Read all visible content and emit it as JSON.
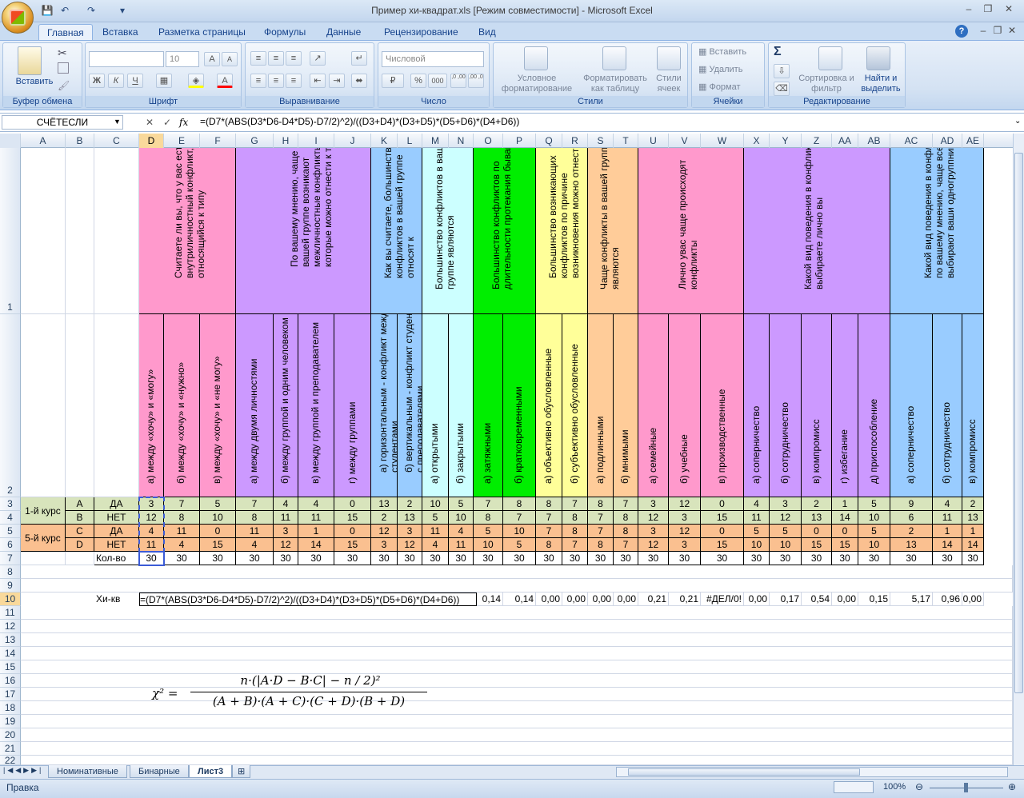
{
  "window": {
    "title": "Пример хи-квадрат.xls  [Режим совместимости] - Microsoft Excel",
    "controls": [
      "–",
      "❐",
      "✕"
    ],
    "doc_controls": [
      "–",
      "❐",
      "✕"
    ]
  },
  "quick_access": [
    "💾",
    "↶",
    "↷",
    "▾"
  ],
  "tabs": [
    "Главная",
    "Вставка",
    "Разметка страницы",
    "Формулы",
    "Данные",
    "Рецензирование",
    "Вид"
  ],
  "ribbon": {
    "clipboard": {
      "label": "Буфер обмена",
      "paste": "Вставить"
    },
    "font": {
      "label": "Шрифт",
      "size": "10",
      "bold": "Ж",
      "italic": "К",
      "underline": "Ч",
      "grow": "A",
      "shrink": "A",
      "color": "A"
    },
    "alignment": {
      "label": "Выравнивание"
    },
    "number": {
      "label": "Число",
      "format": "Числовой",
      "percent": "%",
      "thousands": "000",
      "dec_inc": ",0 ,00",
      "dec_dec": ",00 ,0"
    },
    "styles": {
      "label": "Стили",
      "cond": "Условное форматирование",
      "table": "Форматировать как таблицу",
      "cell": "Стили ячеек"
    },
    "cells": {
      "label": "Ячейки",
      "insert": "Вставить",
      "delete": "Удалить",
      "format": "Формат"
    },
    "editing": {
      "label": "Редактирование",
      "sum": "Σ",
      "sort": "Сортировка и фильтр",
      "find": "Найти и выделить"
    }
  },
  "formula_bar": {
    "name": "СЧЁТЕСЛИ",
    "fx": "fx",
    "formula": "=(D7*(ABS(D3*D6-D4*D5)-D7/2)^2)/((D3+D4)*(D3+D5)*(D5+D6)*(D4+D6))",
    "cancel": "✕",
    "enter": "✓"
  },
  "columns": [
    "A",
    "B",
    "C",
    "D",
    "E",
    "F",
    "G",
    "H",
    "I",
    "J",
    "K",
    "L",
    "M",
    "N",
    "O",
    "P",
    "Q",
    "R",
    "S",
    "T",
    "U",
    "V",
    "W",
    "X",
    "Y",
    "Z",
    "AA",
    "AB",
    "AC",
    "AD",
    "AE"
  ],
  "rows": [
    "1",
    "2",
    "3",
    "4",
    "5",
    "6",
    "7",
    "8",
    "9",
    "10",
    "11",
    "12",
    "13",
    "14",
    "15",
    "16",
    "17",
    "18",
    "19",
    "20",
    "21",
    "22"
  ],
  "questions": [
    "Считаете ли вы, что у вас есть внутриличностный конфликт, относящийся к типу",
    "По вашему мнению, чаще всего в вашей группе возникают межличностные конфликты, которые можно отнести к типу",
    "Как вы считаете, большинство конфликтов в вашей группе относят к",
    "Большинство конфликтов в вашей группе являются",
    "Большинство конфликтов по длительности протекания бывают",
    "Большинство возникающих конфликтов по причине возникновения можно отнести",
    "Чаще конфликты в вашей группе являются",
    "Лично увас чаще происходят конфликты",
    "Какой вид поведения в конфликте выбираете лично вы",
    "Какой вид поведения в конфликте, по вашему мнению, чаще всего выбирают ваши одногруппники"
  ],
  "answers": [
    "а) между «хочу» и «могу»",
    "б) между «хочу» и «нужно»",
    "в) между «хочу» и «не могу»",
    "а) между двумя личностями",
    "б) между группой и одним человеком",
    "в) между группой и преподавателем",
    "г) между группами",
    "а) горизонтальным - конфликт между студентами",
    "б) вертикальным - конфликт студентов с преподавателями",
    "а) открытыми",
    "б) закрытыми",
    "а) затяжными",
    "б) кратковременными",
    "а) объективно обусловленные",
    "б) субъективно обусловленные",
    "а) подлинными",
    "б) мнимыми",
    "а) семейные",
    "б) учебные",
    "в) производственные",
    "а) соперничество",
    "б) сотрудничество",
    "в) компромисс",
    "г) избегание",
    "д) приспособление",
    "а) соперничество",
    "б) сотрудничество",
    "в) компромисс"
  ],
  "groups": {
    "course1": "1-й курс",
    "course5": "5-й курс"
  },
  "row_labels": [
    [
      "A",
      "ДА"
    ],
    [
      "B",
      "НЕТ"
    ],
    [
      "C",
      "ДА"
    ],
    [
      "D",
      "НЕТ"
    ]
  ],
  "count_label": "Кол-во",
  "data": {
    "r3": [
      "3",
      "7",
      "5",
      "7",
      "4",
      "4",
      "0",
      "13",
      "2",
      "10",
      "5",
      "7",
      "8",
      "8",
      "7",
      "8",
      "7",
      "3",
      "12",
      "0",
      "4",
      "3",
      "2",
      "1",
      "5",
      "9",
      "4",
      "2"
    ],
    "r4": [
      "12",
      "8",
      "10",
      "8",
      "11",
      "11",
      "15",
      "2",
      "13",
      "5",
      "10",
      "8",
      "7",
      "7",
      "8",
      "7",
      "8",
      "12",
      "3",
      "15",
      "11",
      "12",
      "13",
      "14",
      "10",
      "6",
      "11",
      "13"
    ],
    "r5": [
      "4",
      "11",
      "0",
      "11",
      "3",
      "1",
      "0",
      "12",
      "3",
      "11",
      "4",
      "5",
      "10",
      "7",
      "8",
      "7",
      "8",
      "3",
      "12",
      "0",
      "5",
      "5",
      "0",
      "0",
      "5",
      "2",
      "1",
      "1"
    ],
    "r6": [
      "11",
      "4",
      "15",
      "4",
      "12",
      "14",
      "15",
      "3",
      "12",
      "4",
      "11",
      "10",
      "5",
      "8",
      "7",
      "8",
      "7",
      "12",
      "3",
      "15",
      "10",
      "10",
      "15",
      "15",
      "10",
      "13",
      "14",
      "14"
    ],
    "r7": [
      "30",
      "30",
      "30",
      "30",
      "30",
      "30",
      "30",
      "30",
      "30",
      "30",
      "30",
      "30",
      "30",
      "30",
      "30",
      "30",
      "30",
      "30",
      "30",
      "30",
      "30",
      "30",
      "30",
      "30",
      "30",
      "30",
      "30",
      "30"
    ]
  },
  "chi_label": "Хи-кв",
  "chi_values": [
    "0,14",
    "0,14",
    "0,00",
    "0,00",
    "0,00",
    "0,00",
    "0,21",
    "0,21",
    "#ДЕЛ/0!",
    "0,00",
    "0,17",
    "0,54",
    "0,00",
    "0,15",
    "5,17",
    "0,96",
    "0,00"
  ],
  "editing_formula": "=(D7*(ABS(D3*D6-D4*D5)-D7/2)^2)/((D3+D4)*(D3+D5)*(D5+D6)*(D4+D6))",
  "chi_formula": {
    "lhs": "χ² =",
    "num": "n·(|A·D − B·C| − n / 2)²",
    "den": "(A + B)·(A + C)·(C + D)·(B + D)"
  },
  "sheets": [
    "Номинативные",
    "Бинарные",
    "Лист3"
  ],
  "status": {
    "mode": "Правка",
    "zoom": "100%"
  }
}
